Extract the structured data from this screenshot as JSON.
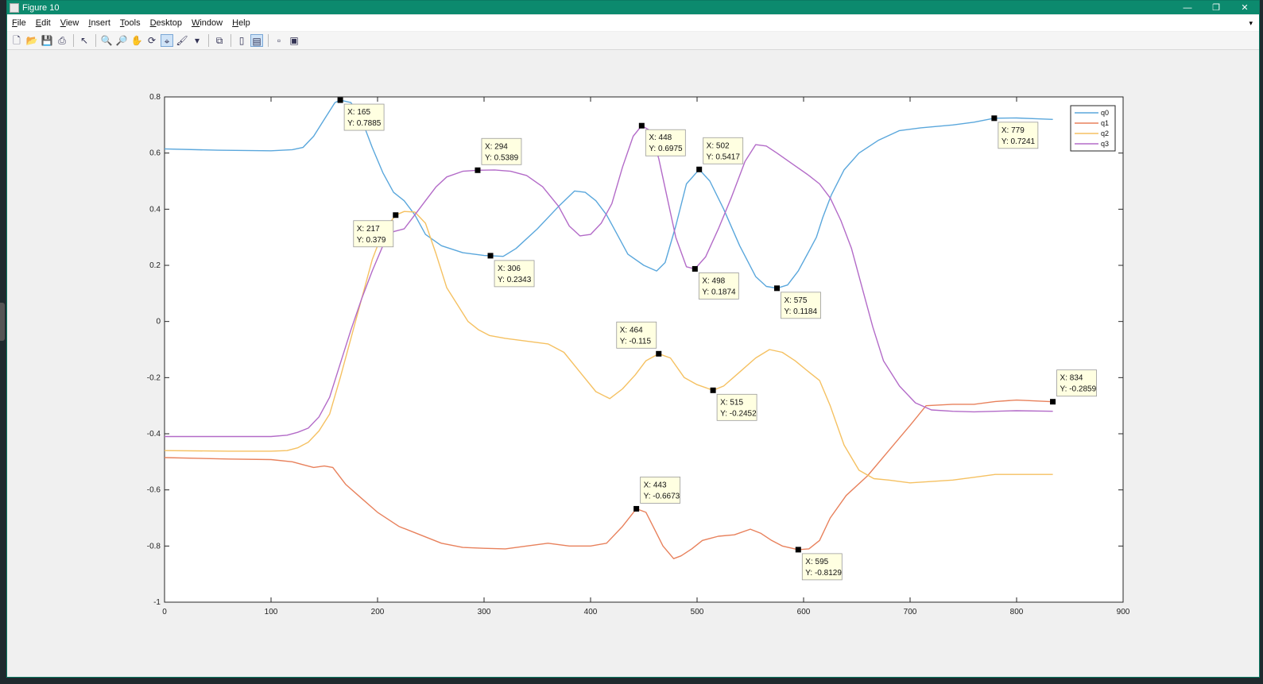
{
  "window": {
    "title": "Figure 10",
    "controls": [
      "—",
      "❐",
      "✕"
    ]
  },
  "menu": [
    {
      "key": "F",
      "rest": "ile"
    },
    {
      "key": "E",
      "rest": "dit"
    },
    {
      "key": "V",
      "rest": "iew"
    },
    {
      "key": "I",
      "rest": "nsert"
    },
    {
      "key": "T",
      "rest": "ools"
    },
    {
      "key": "D",
      "rest": "esktop"
    },
    {
      "key": "W",
      "rest": "indow"
    },
    {
      "key": "H",
      "rest": "elp"
    }
  ],
  "toolbar": [
    {
      "name": "new-figure-icon",
      "glyph": "🗋"
    },
    {
      "name": "open-file-icon",
      "glyph": "📂"
    },
    {
      "name": "save-icon",
      "glyph": "💾"
    },
    {
      "name": "print-icon",
      "glyph": "⎙"
    },
    {
      "name": "sep"
    },
    {
      "name": "edit-plot-arrow-icon",
      "glyph": "↖"
    },
    {
      "name": "sep"
    },
    {
      "name": "zoom-in-icon",
      "glyph": "🔍"
    },
    {
      "name": "zoom-out-icon",
      "glyph": "🔎"
    },
    {
      "name": "pan-icon",
      "glyph": "✋"
    },
    {
      "name": "rotate-3d-icon",
      "glyph": "⟳"
    },
    {
      "name": "data-cursor-icon",
      "glyph": "⌖",
      "active": true
    },
    {
      "name": "brush-icon",
      "glyph": "🖌"
    },
    {
      "name": "brush-dropdown-icon",
      "glyph": "▾"
    },
    {
      "name": "sep"
    },
    {
      "name": "link-plot-icon",
      "glyph": "⧉"
    },
    {
      "name": "sep"
    },
    {
      "name": "colorbar-icon",
      "glyph": "▯"
    },
    {
      "name": "legend-icon",
      "glyph": "▤",
      "active": true
    },
    {
      "name": "sep"
    },
    {
      "name": "hide-plot-tools-icon",
      "glyph": "▫"
    },
    {
      "name": "show-plot-tools-icon",
      "glyph": "▣"
    }
  ],
  "chart_data": {
    "type": "line",
    "xlim": [
      0,
      900
    ],
    "ylim": [
      -1,
      0.8
    ],
    "xticks": [
      0,
      100,
      200,
      300,
      400,
      500,
      600,
      700,
      800,
      900
    ],
    "yticks": [
      -1,
      -0.8,
      -0.6,
      -0.4,
      -0.2,
      0,
      0.2,
      0.4,
      0.6,
      0.8
    ],
    "xtick_labels": [
      "0",
      "100",
      "200",
      "300",
      "400",
      "500",
      "600",
      "700",
      "800",
      "900"
    ],
    "ytick_labels": [
      "-1",
      "-0.8",
      "-0.6",
      "-0.4",
      "-0.2",
      "0",
      "0.2",
      "0.4",
      "0.6",
      "0.8"
    ],
    "grid": false,
    "legend_position": "top-right",
    "series": [
      {
        "name": "q0",
        "color": "#5aa7dc",
        "points": [
          [
            0,
            0.615
          ],
          [
            50,
            0.61
          ],
          [
            100,
            0.608
          ],
          [
            120,
            0.612
          ],
          [
            130,
            0.62
          ],
          [
            140,
            0.66
          ],
          [
            150,
            0.72
          ],
          [
            160,
            0.78
          ],
          [
            165,
            0.7885
          ],
          [
            175,
            0.78
          ],
          [
            185,
            0.72
          ],
          [
            195,
            0.62
          ],
          [
            205,
            0.53
          ],
          [
            215,
            0.46
          ],
          [
            225,
            0.43
          ],
          [
            235,
            0.38
          ],
          [
            245,
            0.31
          ],
          [
            260,
            0.27
          ],
          [
            280,
            0.245
          ],
          [
            300,
            0.235
          ],
          [
            306,
            0.2343
          ],
          [
            318,
            0.232
          ],
          [
            330,
            0.26
          ],
          [
            350,
            0.33
          ],
          [
            370,
            0.41
          ],
          [
            385,
            0.465
          ],
          [
            395,
            0.46
          ],
          [
            405,
            0.43
          ],
          [
            415,
            0.38
          ],
          [
            425,
            0.31
          ],
          [
            435,
            0.24
          ],
          [
            450,
            0.2
          ],
          [
            462,
            0.18
          ],
          [
            470,
            0.21
          ],
          [
            480,
            0.34
          ],
          [
            490,
            0.49
          ],
          [
            502,
            0.5417
          ],
          [
            512,
            0.5
          ],
          [
            525,
            0.4
          ],
          [
            540,
            0.27
          ],
          [
            555,
            0.16
          ],
          [
            565,
            0.125
          ],
          [
            575,
            0.1184
          ],
          [
            585,
            0.13
          ],
          [
            595,
            0.18
          ],
          [
            605,
            0.25
          ],
          [
            612,
            0.3
          ],
          [
            618,
            0.37
          ],
          [
            626,
            0.45
          ],
          [
            638,
            0.54
          ],
          [
            652,
            0.6
          ],
          [
            670,
            0.645
          ],
          [
            690,
            0.68
          ],
          [
            710,
            0.69
          ],
          [
            740,
            0.7
          ],
          [
            760,
            0.71
          ],
          [
            779,
            0.7241
          ],
          [
            800,
            0.725
          ],
          [
            820,
            0.722
          ],
          [
            834,
            0.72
          ]
        ]
      },
      {
        "name": "q1",
        "color": "#e8815c",
        "points": [
          [
            0,
            -0.485
          ],
          [
            60,
            -0.49
          ],
          [
            100,
            -0.492
          ],
          [
            120,
            -0.5
          ],
          [
            130,
            -0.51
          ],
          [
            140,
            -0.52
          ],
          [
            150,
            -0.515
          ],
          [
            158,
            -0.52
          ],
          [
            170,
            -0.58
          ],
          [
            185,
            -0.63
          ],
          [
            200,
            -0.68
          ],
          [
            220,
            -0.73
          ],
          [
            240,
            -0.76
          ],
          [
            260,
            -0.79
          ],
          [
            280,
            -0.805
          ],
          [
            300,
            -0.808
          ],
          [
            320,
            -0.81
          ],
          [
            340,
            -0.8
          ],
          [
            360,
            -0.79
          ],
          [
            380,
            -0.8
          ],
          [
            400,
            -0.8
          ],
          [
            415,
            -0.79
          ],
          [
            430,
            -0.73
          ],
          [
            443,
            -0.6673
          ],
          [
            452,
            -0.68
          ],
          [
            460,
            -0.74
          ],
          [
            468,
            -0.8
          ],
          [
            478,
            -0.845
          ],
          [
            485,
            -0.835
          ],
          [
            495,
            -0.81
          ],
          [
            505,
            -0.78
          ],
          [
            520,
            -0.765
          ],
          [
            535,
            -0.76
          ],
          [
            550,
            -0.74
          ],
          [
            560,
            -0.755
          ],
          [
            570,
            -0.78
          ],
          [
            580,
            -0.8
          ],
          [
            595,
            -0.8129
          ],
          [
            605,
            -0.81
          ],
          [
            615,
            -0.78
          ],
          [
            625,
            -0.7
          ],
          [
            640,
            -0.62
          ],
          [
            660,
            -0.55
          ],
          [
            680,
            -0.46
          ],
          [
            700,
            -0.37
          ],
          [
            715,
            -0.3
          ],
          [
            740,
            -0.295
          ],
          [
            760,
            -0.295
          ],
          [
            780,
            -0.285
          ],
          [
            800,
            -0.28
          ],
          [
            834,
            -0.2859
          ]
        ]
      },
      {
        "name": "q2",
        "color": "#f5c162",
        "points": [
          [
            0,
            -0.46
          ],
          [
            60,
            -0.462
          ],
          [
            100,
            -0.462
          ],
          [
            115,
            -0.46
          ],
          [
            125,
            -0.45
          ],
          [
            135,
            -0.43
          ],
          [
            145,
            -0.39
          ],
          [
            155,
            -0.33
          ],
          [
            165,
            -0.2
          ],
          [
            175,
            -0.06
          ],
          [
            185,
            0.08
          ],
          [
            195,
            0.22
          ],
          [
            205,
            0.32
          ],
          [
            217,
            0.379
          ],
          [
            225,
            0.392
          ],
          [
            235,
            0.39
          ],
          [
            245,
            0.35
          ],
          [
            255,
            0.24
          ],
          [
            265,
            0.12
          ],
          [
            275,
            0.06
          ],
          [
            285,
            0.0
          ],
          [
            295,
            -0.03
          ],
          [
            305,
            -0.05
          ],
          [
            320,
            -0.06
          ],
          [
            340,
            -0.07
          ],
          [
            360,
            -0.08
          ],
          [
            375,
            -0.11
          ],
          [
            390,
            -0.18
          ],
          [
            405,
            -0.25
          ],
          [
            418,
            -0.275
          ],
          [
            430,
            -0.24
          ],
          [
            442,
            -0.19
          ],
          [
            452,
            -0.14
          ],
          [
            464,
            -0.115
          ],
          [
            475,
            -0.13
          ],
          [
            488,
            -0.2
          ],
          [
            500,
            -0.225
          ],
          [
            515,
            -0.2452
          ],
          [
            525,
            -0.23
          ],
          [
            540,
            -0.18
          ],
          [
            555,
            -0.13
          ],
          [
            568,
            -0.1
          ],
          [
            580,
            -0.11
          ],
          [
            592,
            -0.14
          ],
          [
            605,
            -0.18
          ],
          [
            615,
            -0.21
          ],
          [
            625,
            -0.3
          ],
          [
            638,
            -0.44
          ],
          [
            652,
            -0.53
          ],
          [
            666,
            -0.56
          ],
          [
            680,
            -0.565
          ],
          [
            700,
            -0.575
          ],
          [
            720,
            -0.57
          ],
          [
            740,
            -0.565
          ],
          [
            760,
            -0.555
          ],
          [
            780,
            -0.545
          ],
          [
            800,
            -0.545
          ],
          [
            834,
            -0.545
          ]
        ]
      },
      {
        "name": "q3",
        "color": "#b36bc8",
        "points": [
          [
            0,
            -0.41
          ],
          [
            60,
            -0.41
          ],
          [
            100,
            -0.41
          ],
          [
            115,
            -0.405
          ],
          [
            125,
            -0.395
          ],
          [
            135,
            -0.38
          ],
          [
            145,
            -0.34
          ],
          [
            155,
            -0.27
          ],
          [
            165,
            -0.15
          ],
          [
            175,
            -0.03
          ],
          [
            185,
            0.08
          ],
          [
            195,
            0.18
          ],
          [
            205,
            0.27
          ],
          [
            215,
            0.32
          ],
          [
            225,
            0.33
          ],
          [
            235,
            0.38
          ],
          [
            245,
            0.43
          ],
          [
            255,
            0.48
          ],
          [
            265,
            0.515
          ],
          [
            280,
            0.535
          ],
          [
            294,
            0.5389
          ],
          [
            310,
            0.54
          ],
          [
            325,
            0.535
          ],
          [
            340,
            0.52
          ],
          [
            355,
            0.48
          ],
          [
            370,
            0.41
          ],
          [
            380,
            0.34
          ],
          [
            390,
            0.305
          ],
          [
            400,
            0.31
          ],
          [
            410,
            0.35
          ],
          [
            420,
            0.42
          ],
          [
            430,
            0.55
          ],
          [
            440,
            0.66
          ],
          [
            448,
            0.6975
          ],
          [
            456,
            0.68
          ],
          [
            464,
            0.58
          ],
          [
            472,
            0.44
          ],
          [
            480,
            0.3
          ],
          [
            490,
            0.195
          ],
          [
            498,
            0.1874
          ],
          [
            508,
            0.23
          ],
          [
            520,
            0.33
          ],
          [
            532,
            0.44
          ],
          [
            545,
            0.57
          ],
          [
            555,
            0.63
          ],
          [
            565,
            0.625
          ],
          [
            575,
            0.6
          ],
          [
            590,
            0.56
          ],
          [
            605,
            0.52
          ],
          [
            615,
            0.49
          ],
          [
            625,
            0.44
          ],
          [
            635,
            0.36
          ],
          [
            645,
            0.26
          ],
          [
            655,
            0.12
          ],
          [
            665,
            -0.02
          ],
          [
            675,
            -0.14
          ],
          [
            690,
            -0.23
          ],
          [
            705,
            -0.29
          ],
          [
            720,
            -0.315
          ],
          [
            740,
            -0.32
          ],
          [
            760,
            -0.322
          ],
          [
            780,
            -0.32
          ],
          [
            800,
            -0.318
          ],
          [
            834,
            -0.32
          ]
        ]
      }
    ],
    "datatips": [
      {
        "series": "q0",
        "x": 165,
        "y": 0.7885,
        "label_x": "X: 165",
        "label_y": "Y: 0.7885",
        "box_dx": 5,
        "box_dy": 5
      },
      {
        "series": "q3",
        "x": 294,
        "y": 0.5389,
        "label_x": "X: 294",
        "label_y": "Y: 0.5389",
        "box_dx": 5,
        "box_dy": -40
      },
      {
        "series": "q2",
        "x": 217,
        "y": 0.379,
        "label_x": "X: 217",
        "label_y": "Y: 0.379",
        "box_dx": -53,
        "box_dy": 7
      },
      {
        "series": "q0",
        "x": 306,
        "y": 0.2343,
        "label_x": "X: 306",
        "label_y": "Y: 0.2343",
        "box_dx": 5,
        "box_dy": 6
      },
      {
        "series": "q3",
        "x": 448,
        "y": 0.6975,
        "label_x": "X: 448",
        "label_y": "Y: 0.6975",
        "box_dx": 5,
        "box_dy": 5
      },
      {
        "series": "q0",
        "x": 502,
        "y": 0.5417,
        "label_x": "X: 502",
        "label_y": "Y: 0.5417",
        "box_dx": 5,
        "box_dy": -40
      },
      {
        "series": "q3",
        "x": 498,
        "y": 0.1874,
        "label_x": "X: 498",
        "label_y": "Y: 0.1874",
        "box_dx": 5,
        "box_dy": 5
      },
      {
        "series": "q0",
        "x": 575,
        "y": 0.1184,
        "label_x": "X: 575",
        "label_y": "Y: 0.1184",
        "box_dx": 5,
        "box_dy": 5
      },
      {
        "series": "q0",
        "x": 779,
        "y": 0.7241,
        "label_x": "X: 779",
        "label_y": "Y: 0.7241",
        "box_dx": 5,
        "box_dy": 5
      },
      {
        "series": "q2",
        "x": 464,
        "y": -0.115,
        "label_x": "X: 464",
        "label_y": "Y: -0.115",
        "box_dx": -53,
        "box_dy": -40
      },
      {
        "series": "q2",
        "x": 515,
        "y": -0.2452,
        "label_x": "X: 515",
        "label_y": "Y: -0.2452",
        "box_dx": 5,
        "box_dy": 5
      },
      {
        "series": "q1",
        "x": 834,
        "y": -0.2859,
        "label_x": "X: 834",
        "label_y": "Y: -0.2859",
        "box_dx": 5,
        "box_dy": -40
      },
      {
        "series": "q1",
        "x": 443,
        "y": -0.6673,
        "label_x": "X: 443",
        "label_y": "Y: -0.6673",
        "box_dx": 5,
        "box_dy": -40
      },
      {
        "series": "q1",
        "x": 595,
        "y": -0.8129,
        "label_x": "X: 595",
        "label_y": "Y: -0.8129",
        "box_dx": 5,
        "box_dy": 5
      }
    ]
  }
}
